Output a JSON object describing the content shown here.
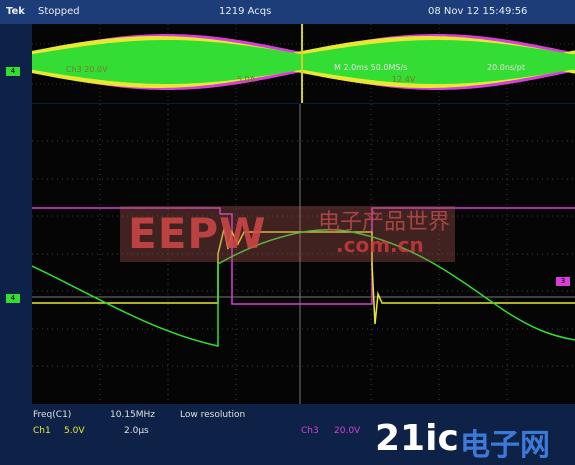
{
  "topbar": {
    "brand": "Tek",
    "state": "Stopped",
    "acqs": "1219 Acqs",
    "datetime": "08 Nov 12 15:49:56"
  },
  "zoom_readout": {
    "ch3": "Ch3  20.0V",
    "ch2": "5.0A",
    "timebase": "M 2.0ms 50.0MS/s",
    "ptpt": "20.0ns/pt",
    "level": "12.4V"
  },
  "channel_markers": {
    "zoom": "4",
    "main": "4",
    "main_ch3": "3"
  },
  "measurement": {
    "label": "Freq(C1)",
    "value": "10.15MHz",
    "note": "Low resolution"
  },
  "status": {
    "ch1": "Ch1",
    "ch1_scale": "5.0V",
    "timebase": "2.0μs",
    "ch3": "Ch3",
    "ch3_scale": "20.0V"
  },
  "watermarks": {
    "eepw": "EEPW",
    "eepw_cn": "电子产品世界",
    "eepw_url": ".com.cn",
    "site": "21ic",
    "site_cn": "电子网"
  },
  "colors": {
    "ch1": "#e8e832",
    "ch2": "#33dd33",
    "ch3": "#d83fd8",
    "ch4": "#33dd33",
    "grid": "#3a3a3a"
  }
}
